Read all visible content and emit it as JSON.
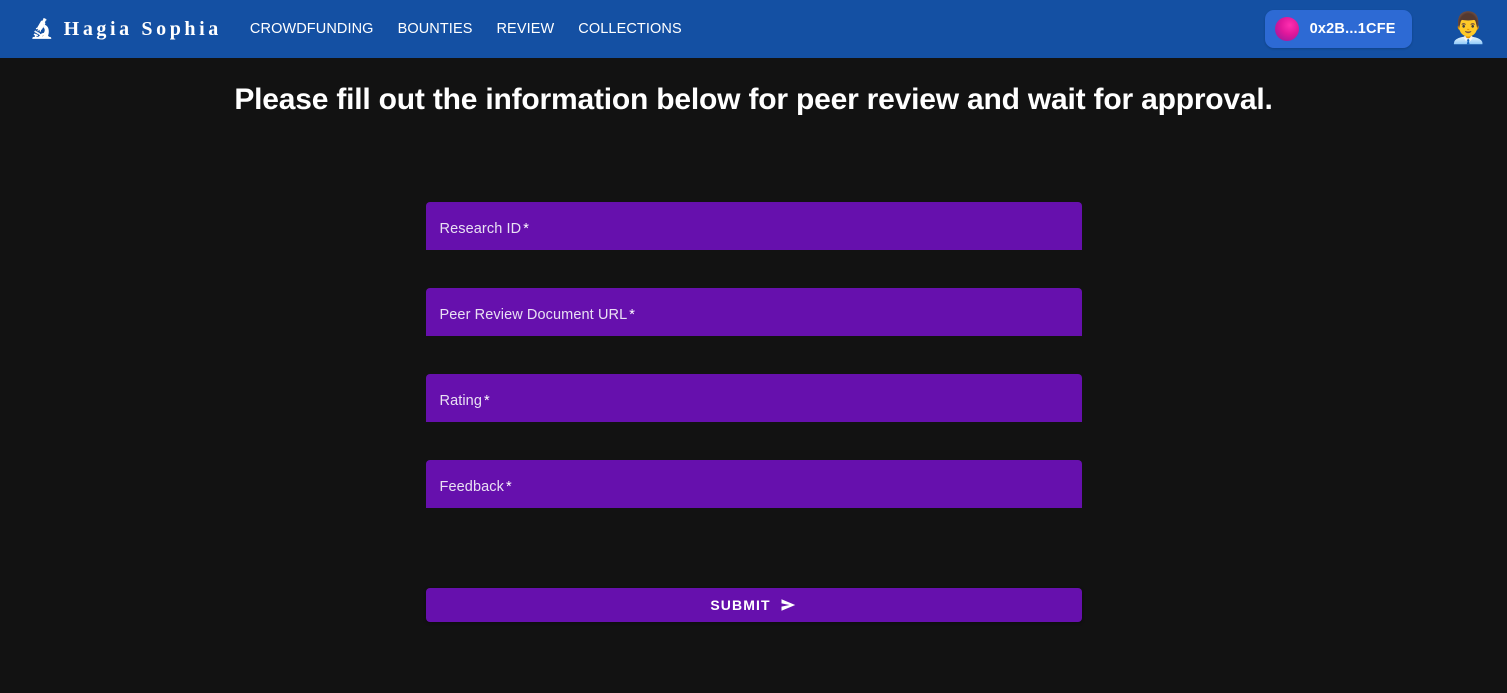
{
  "navbar": {
    "brand": {
      "icon": "microscope-icon",
      "icon_glyph": "🔬",
      "title": "Hagia Sophia"
    },
    "links": [
      {
        "label": "CROWDFUNDING"
      },
      {
        "label": "BOUNTIES"
      },
      {
        "label": "REVIEW"
      },
      {
        "label": "COLLECTIONS"
      }
    ],
    "wallet": {
      "icon": "wallet-avatar-icon",
      "address": "0x2B...1CFE"
    },
    "avatar": {
      "icon": "business-person-avatar-icon",
      "glyph": "👨‍💼"
    },
    "colors": {
      "background": "#1450a3",
      "wallet_chip": "#2d6ad4",
      "wallet_dot": "#e0189b"
    }
  },
  "page": {
    "heading": "Please fill out the information below for peer review and wait for approval.",
    "background": "#121212"
  },
  "form": {
    "field_color": "#6610ad",
    "fields": [
      {
        "label": "Research ID",
        "required_mark": "*",
        "value": "",
        "placeholder": ""
      },
      {
        "label": "Peer Review Document URL",
        "required_mark": "*",
        "value": "",
        "placeholder": ""
      },
      {
        "label": "Rating",
        "required_mark": "*",
        "value": "",
        "placeholder": ""
      },
      {
        "label": "Feedback",
        "required_mark": "*",
        "value": "",
        "placeholder": ""
      }
    ],
    "submit": {
      "label": "SUBMIT",
      "icon": "send-arrow-icon",
      "icon_glyph": "➤"
    }
  }
}
